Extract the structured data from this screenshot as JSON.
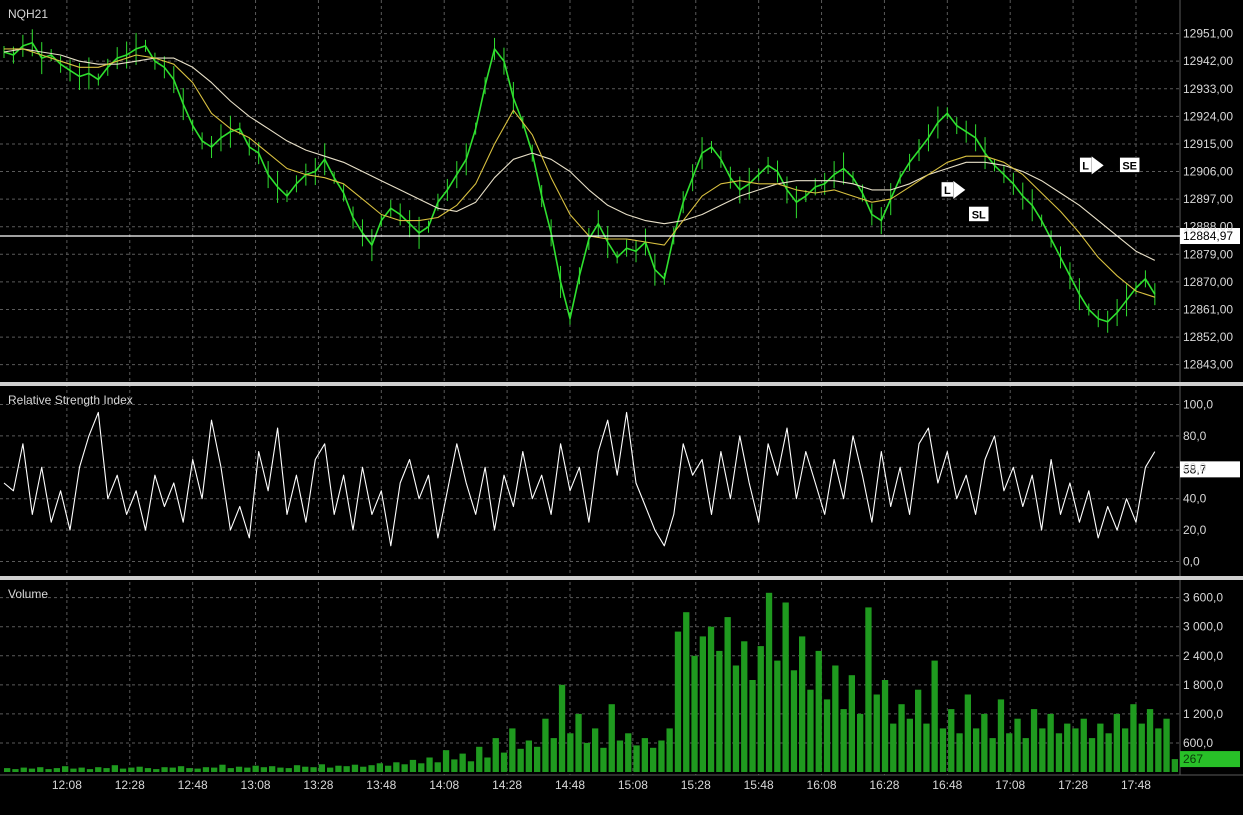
{
  "colors": {
    "background": "#000000",
    "grid": "#5a5a5a",
    "price": "#2fe02f",
    "ma_slow": "#e8e0c8",
    "ma_fast": "#d8c040",
    "rsi": "#ffffff",
    "volume": "#1f9a1f",
    "volume_current": "#28c028",
    "text": "#d8d8d8",
    "separator": "#cfcfcf",
    "price_line": "#ffffff"
  },
  "chart_data": [
    {
      "type": "line",
      "panel": "price",
      "title": "NQH21",
      "ylim": [
        12838,
        12960
      ],
      "yticks": [
        "12951,00",
        "12942,00",
        "12933,00",
        "12924,00",
        "12915,00",
        "12906,00",
        "12897,00",
        "12888,00",
        "12879,00",
        "12870,00",
        "12861,00",
        "12852,00",
        "12843,00"
      ],
      "current_label": "12884,97",
      "current_value": 12884.97,
      "series": [
        {
          "role": "price",
          "x": [
            0,
            3,
            6,
            9,
            12,
            15,
            18,
            21,
            24,
            27,
            30,
            33,
            36,
            39,
            42,
            45,
            48,
            51,
            54,
            57,
            60,
            63,
            66,
            69,
            72,
            75,
            78,
            81,
            84,
            87,
            90,
            93,
            96,
            99,
            102,
            105,
            108,
            111,
            114,
            117,
            120,
            123,
            126,
            129,
            132,
            135,
            138,
            141,
            144,
            147,
            150,
            153,
            156,
            159,
            162,
            165,
            168,
            171,
            174,
            177,
            180,
            183,
            186,
            189,
            192,
            195,
            198,
            201,
            204,
            207,
            210,
            213,
            216,
            219,
            222,
            225,
            228,
            231,
            234,
            237,
            240,
            243,
            246,
            249,
            252,
            255,
            258,
            261,
            264,
            267,
            270,
            273,
            276,
            279,
            282,
            285,
            288,
            291,
            294,
            297,
            300,
            303,
            306,
            309,
            312,
            315,
            318,
            321,
            324,
            327,
            330,
            333,
            336,
            339,
            342,
            345,
            348,
            351,
            354,
            357,
            360,
            363,
            366
          ],
          "values": [
            12945,
            12944,
            12947,
            12948,
            12943,
            12944,
            12941,
            12939,
            12937,
            12938,
            12936,
            12940,
            12943,
            12944,
            12946,
            12947,
            12942,
            12940,
            12936,
            12928,
            12921,
            12916,
            12914,
            12917,
            12919,
            12920,
            12914,
            12912,
            12905,
            12901,
            12898,
            12902,
            12905,
            12906,
            12910,
            12904,
            12899,
            12891,
            12886,
            12882,
            12890,
            12894,
            12892,
            12889,
            12886,
            12888,
            12896,
            12900,
            12905,
            12910,
            12920,
            12934,
            12946,
            12942,
            12930,
            12922,
            12912,
            12898,
            12886,
            12870,
            12858,
            12872,
            12884,
            12889,
            12883,
            12878,
            12881,
            12880,
            12883,
            12874,
            12871,
            12885,
            12896,
            12904,
            12912,
            12914,
            12910,
            12904,
            12900,
            12902,
            12905,
            12908,
            12906,
            12900,
            12896,
            12898,
            12901,
            12902,
            12905,
            12907,
            12904,
            12899,
            12892,
            12890,
            12897,
            12904,
            12909,
            12913,
            12917,
            12922,
            12925,
            12921,
            12919,
            12917,
            12912,
            12908,
            12905,
            12902,
            12898,
            12895,
            12890,
            12884,
            12878,
            12872,
            12866,
            12861,
            12858,
            12857,
            12860,
            12864,
            12868,
            12871,
            12866
          ]
        },
        {
          "role": "ma_slow",
          "x": [
            0,
            6,
            12,
            18,
            24,
            30,
            36,
            42,
            48,
            54,
            60,
            66,
            72,
            78,
            84,
            90,
            96,
            102,
            108,
            114,
            120,
            126,
            132,
            138,
            144,
            150,
            156,
            162,
            168,
            174,
            180,
            186,
            192,
            198,
            204,
            210,
            216,
            222,
            228,
            234,
            240,
            246,
            252,
            258,
            264,
            270,
            276,
            282,
            288,
            294,
            300,
            306,
            312,
            318,
            324,
            330,
            336,
            342,
            348,
            354,
            360,
            366
          ],
          "values": [
            12945,
            12946,
            12945,
            12944,
            12942,
            12941,
            12941,
            12942,
            12943,
            12943,
            12940,
            12935,
            12929,
            12924,
            12920,
            12916,
            12913,
            12911,
            12909,
            12906,
            12903,
            12900,
            12897,
            12894,
            12893,
            12896,
            12904,
            12910,
            12912,
            12910,
            12906,
            12900,
            12895,
            12892,
            12890,
            12889,
            12890,
            12892,
            12895,
            12898,
            12900,
            12902,
            12903,
            12903,
            12903,
            12902,
            12900,
            12900,
            12902,
            12905,
            12907,
            12909,
            12909,
            12908,
            12906,
            12903,
            12899,
            12895,
            12890,
            12885,
            12880,
            12877
          ]
        },
        {
          "role": "ma_fast",
          "x": [
            0,
            6,
            12,
            18,
            24,
            30,
            36,
            42,
            48,
            54,
            60,
            66,
            72,
            78,
            84,
            90,
            96,
            102,
            108,
            114,
            120,
            126,
            132,
            138,
            144,
            150,
            156,
            162,
            168,
            174,
            180,
            186,
            192,
            198,
            204,
            210,
            216,
            222,
            228,
            234,
            240,
            246,
            252,
            258,
            264,
            270,
            276,
            282,
            288,
            294,
            300,
            306,
            312,
            318,
            324,
            330,
            336,
            342,
            348,
            354,
            360,
            366
          ],
          "values": [
            12946,
            12946,
            12944,
            12942,
            12940,
            12940,
            12942,
            12944,
            12943,
            12941,
            12935,
            12925,
            12920,
            12917,
            12912,
            12907,
            12905,
            12904,
            12902,
            12897,
            12892,
            12890,
            12890,
            12891,
            12895,
            12902,
            12915,
            12926,
            12918,
            12904,
            12892,
            12885,
            12884,
            12884,
            12883,
            12882,
            12890,
            12898,
            12902,
            12903,
            12902,
            12902,
            12900,
            12899,
            12900,
            12898,
            12896,
            12897,
            12901,
            12905,
            12909,
            12911,
            12911,
            12909,
            12905,
            12899,
            12893,
            12886,
            12878,
            12872,
            12867,
            12865
          ]
        }
      ],
      "markers": [
        {
          "label": "L",
          "x": 300,
          "y": 12900
        },
        {
          "label": "SL",
          "x": 310,
          "y": 12892
        },
        {
          "label": "L",
          "x": 344,
          "y": 12908
        },
        {
          "label": "SE",
          "x": 358,
          "y": 12908
        }
      ]
    },
    {
      "type": "line",
      "panel": "rsi",
      "title": "Relative Strength Index",
      "ylim": [
        -8,
        108
      ],
      "yticks": [
        "100,0",
        "80,0",
        "60,0",
        "40,0",
        "20,0",
        "0,0"
      ],
      "ytick_values": [
        100,
        80,
        60,
        40,
        20,
        0
      ],
      "current_label": "58,7",
      "current_value": 58.7,
      "series": [
        {
          "role": "rsi",
          "x": [
            0,
            3,
            6,
            9,
            12,
            15,
            18,
            21,
            24,
            27,
            30,
            33,
            36,
            39,
            42,
            45,
            48,
            51,
            54,
            57,
            60,
            63,
            66,
            69,
            72,
            75,
            78,
            81,
            84,
            87,
            90,
            93,
            96,
            99,
            102,
            105,
            108,
            111,
            114,
            117,
            120,
            123,
            126,
            129,
            132,
            135,
            138,
            141,
            144,
            147,
            150,
            153,
            156,
            159,
            162,
            165,
            168,
            171,
            174,
            177,
            180,
            183,
            186,
            189,
            192,
            195,
            198,
            201,
            204,
            207,
            210,
            213,
            216,
            219,
            222,
            225,
            228,
            231,
            234,
            237,
            240,
            243,
            246,
            249,
            252,
            255,
            258,
            261,
            264,
            267,
            270,
            273,
            276,
            279,
            282,
            285,
            288,
            291,
            294,
            297,
            300,
            303,
            306,
            309,
            312,
            315,
            318,
            321,
            324,
            327,
            330,
            333,
            336,
            339,
            342,
            345,
            348,
            351,
            354,
            357,
            360,
            363,
            366
          ],
          "values": [
            50,
            45,
            75,
            30,
            60,
            25,
            45,
            20,
            60,
            80,
            95,
            40,
            55,
            30,
            45,
            20,
            55,
            35,
            50,
            25,
            65,
            40,
            90,
            60,
            20,
            35,
            15,
            70,
            45,
            85,
            30,
            55,
            25,
            65,
            75,
            30,
            55,
            20,
            60,
            30,
            45,
            10,
            50,
            65,
            40,
            55,
            15,
            45,
            75,
            50,
            30,
            60,
            20,
            55,
            35,
            70,
            40,
            55,
            30,
            75,
            45,
            60,
            25,
            70,
            90,
            55,
            95,
            50,
            35,
            20,
            10,
            30,
            75,
            55,
            65,
            30,
            70,
            40,
            80,
            50,
            25,
            75,
            55,
            85,
            40,
            70,
            50,
            30,
            65,
            40,
            80,
            55,
            25,
            70,
            35,
            60,
            30,
            75,
            85,
            50,
            70,
            40,
            55,
            30,
            65,
            80,
            45,
            60,
            35,
            55,
            20,
            65,
            30,
            50,
            25,
            45,
            15,
            35,
            20,
            40,
            25,
            60,
            70
          ]
        }
      ]
    },
    {
      "type": "bar",
      "panel": "volume",
      "title": "Volume",
      "ylim": [
        0,
        3800
      ],
      "yticks": [
        "3 600,0",
        "3 000,0",
        "2 400,0",
        "1 800,0",
        "1 200,0",
        "600,0"
      ],
      "ytick_values": [
        3600,
        3000,
        2400,
        1800,
        1200,
        600
      ],
      "current_label": "267",
      "current_value": 267,
      "series": [
        {
          "role": "volume",
          "values": [
            80,
            60,
            90,
            70,
            100,
            60,
            80,
            120,
            70,
            90,
            60,
            100,
            80,
            140,
            70,
            90,
            110,
            80,
            60,
            100,
            90,
            120,
            80,
            70,
            100,
            90,
            150,
            80,
            110,
            90,
            130,
            100,
            120,
            90,
            80,
            140,
            110,
            100,
            160,
            90,
            130,
            120,
            150,
            110,
            140,
            180,
            130,
            200,
            160,
            250,
            180,
            300,
            200,
            450,
            260,
            380,
            220,
            520,
            300,
            700,
            400,
            900,
            480,
            650,
            520,
            1100,
            700,
            1800,
            800,
            1200,
            600,
            900,
            500,
            1400,
            650,
            800,
            550,
            700,
            500,
            650,
            900,
            2900,
            3300,
            2400,
            2800,
            3000,
            2500,
            3200,
            2200,
            2700,
            1900,
            2600,
            3700,
            2300,
            3500,
            2100,
            2800,
            1700,
            2500,
            1500,
            2200,
            1300,
            2000,
            1200,
            3400,
            1600,
            1900,
            1000,
            1400,
            1100,
            1700,
            1000,
            2300,
            900,
            1300,
            800,
            1600,
            900,
            1200,
            700,
            1500,
            800,
            1100,
            700,
            1300,
            900,
            1200,
            800,
            1000,
            900,
            1100,
            700,
            1000,
            800,
            1200,
            900,
            1400,
            1000,
            1300,
            900,
            1100,
            267
          ]
        }
      ]
    }
  ],
  "time_axis": {
    "labels": [
      "12:08",
      "12:28",
      "12:48",
      "13:08",
      "13:28",
      "13:48",
      "14:08",
      "14:28",
      "14:48",
      "15:08",
      "15:28",
      "15:48",
      "16:08",
      "16:28",
      "16:48",
      "17:08",
      "17:28",
      "17:48"
    ],
    "label_steps": [
      20,
      40,
      60,
      80,
      100,
      120,
      140,
      160,
      180,
      200,
      220,
      240,
      260,
      280,
      300,
      320,
      340,
      360
    ],
    "span": 374
  },
  "labels": {
    "price_title": "NQH21",
    "rsi_title": "Relative Strength Index",
    "volume_title": "Volume"
  }
}
